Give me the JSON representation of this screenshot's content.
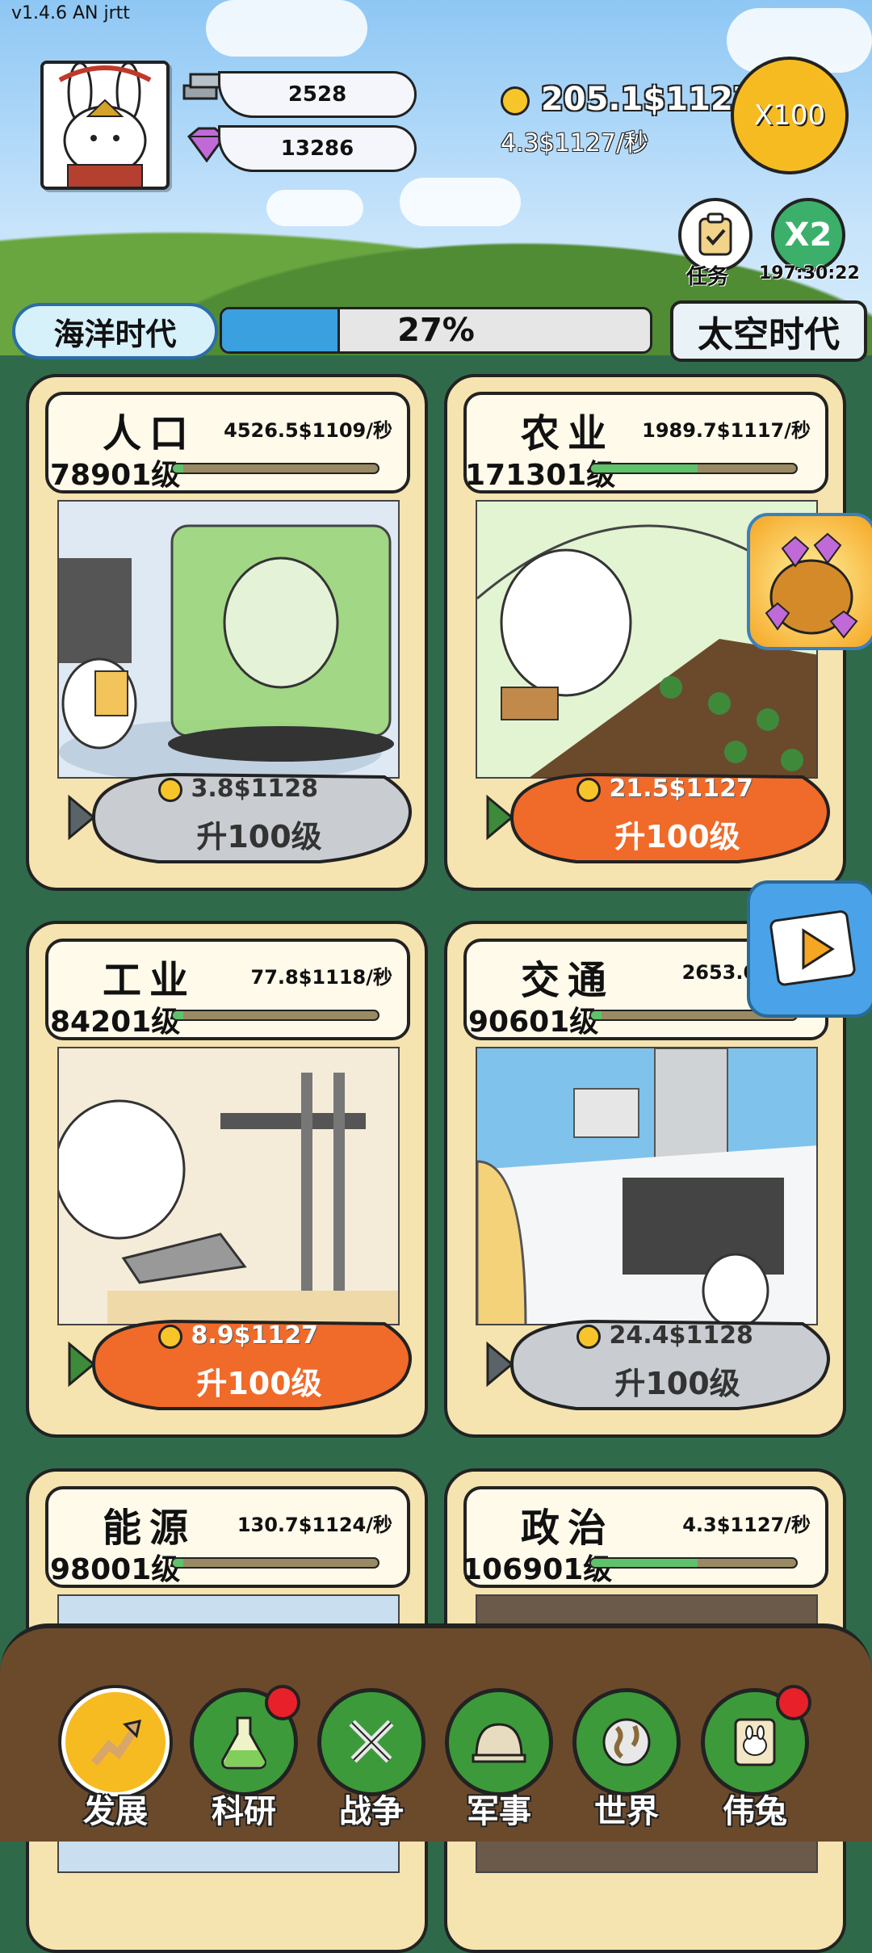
{
  "version": "v1.4.6 AN jrtt",
  "header": {
    "silver": "2528",
    "gems": "13286",
    "coins": "205.1$1127",
    "coin_rate": "4.3$1127/秒",
    "multiplier": "X100",
    "task_label": "任务",
    "boost_label": "X2",
    "boost_timer": "197:30:22"
  },
  "era": {
    "current": "海洋时代",
    "next": "太空时代",
    "progress_text": "27%",
    "progress_value": 27
  },
  "cards": [
    {
      "title": "人口",
      "rate": "4526.5$1109/秒",
      "level": "78901级",
      "bar": 0.05,
      "cost": "3.8$1128",
      "upgrade": "升100级",
      "style": "grey"
    },
    {
      "title": "农业",
      "rate": "1989.7$1117/秒",
      "level": "171301级",
      "bar": 0.52,
      "cost": "21.5$1127",
      "upgrade": "升100级",
      "style": "orange"
    },
    {
      "title": "工业",
      "rate": "77.8$1118/秒",
      "level": "84201级",
      "bar": 0.05,
      "cost": "8.9$1127",
      "upgrade": "升100级",
      "style": "orange"
    },
    {
      "title": "交通",
      "rate": "2653.0$112",
      "level": "90601级",
      "bar": 0.05,
      "cost": "24.4$1128",
      "upgrade": "升100级",
      "style": "grey"
    },
    {
      "title": "能源",
      "rate": "130.7$1124/秒",
      "level": "98001级",
      "bar": 0.05
    },
    {
      "title": "政治",
      "rate": "4.3$1127/秒",
      "level": "106901级",
      "bar": 0.52
    }
  ],
  "nav": [
    {
      "label": "发展",
      "icon": "develop-icon",
      "active": true,
      "badge": false
    },
    {
      "label": "科研",
      "icon": "flask-icon",
      "active": false,
      "badge": true
    },
    {
      "label": "战争",
      "icon": "swords-icon",
      "active": false,
      "badge": false
    },
    {
      "label": "军事",
      "icon": "helmet-icon",
      "active": false,
      "badge": false
    },
    {
      "label": "世界",
      "icon": "globe-icon",
      "active": false,
      "badge": false
    },
    {
      "label": "伟兔",
      "icon": "rabbit-portrait-icon",
      "active": false,
      "badge": true
    }
  ],
  "colors": {
    "accent": "#f7bb22",
    "progress": "#3aa0e0",
    "nav_green": "#3d9a3a",
    "badge": "#e8202a"
  }
}
